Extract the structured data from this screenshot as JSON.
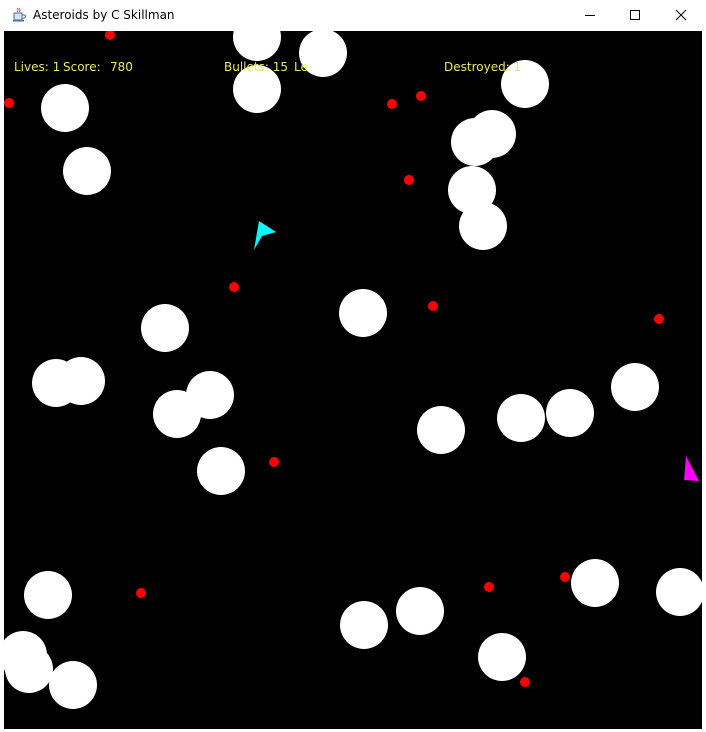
{
  "window": {
    "title": "Asteroids by C Skillman",
    "app_icon": "java-coffee-cup-icon",
    "controls": {
      "minimize_icon": "minimize-icon",
      "maximize_icon": "maximize-icon",
      "close_icon": "close-icon"
    }
  },
  "hud": {
    "lives_label": "Lives: 1",
    "score_label": "Score:",
    "score_value": "780",
    "bullets_label": "Bullets: 15",
    "level_label": "Le",
    "destroyed_label": "Destroyed: 1"
  },
  "colors": {
    "background": "#000000",
    "hud_text": "#e8e860",
    "asteroid": "#ffffff",
    "bullet": "#ff0000",
    "player_ship": "#00ffff",
    "enemy_ship": "#ff00ff"
  }
}
